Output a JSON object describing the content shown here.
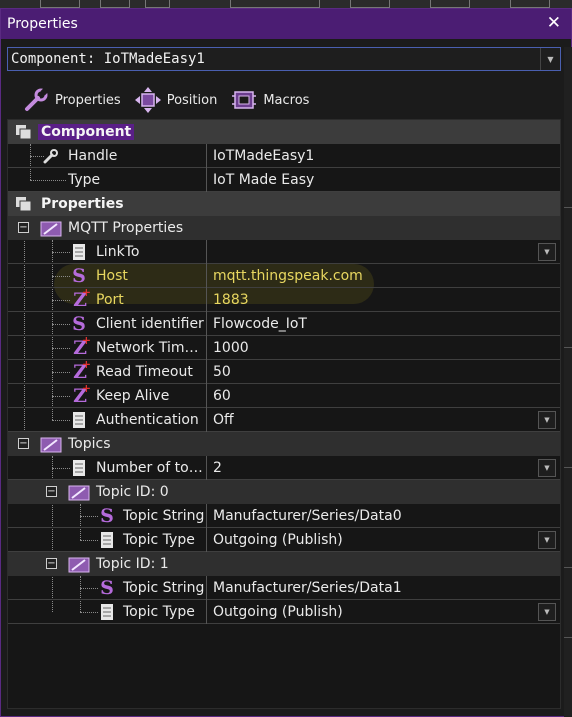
{
  "window": {
    "title": "Properties",
    "close_glyph": "✕"
  },
  "component_select": {
    "value": "Component: IoTMadeEasy1"
  },
  "toolbar": {
    "properties_label": "Properties",
    "position_label": "Position",
    "macros_label": "Macros"
  },
  "grid": {
    "component_header": "Component",
    "handle_label": "Handle",
    "handle_value": "IoTMadeEasy1",
    "type_label": "Type",
    "type_value": "IoT Made Easy",
    "properties_header": "Properties",
    "mqtt_group": "MQTT Properties",
    "linkto_label": "LinkTo",
    "linkto_value": "",
    "host_label": "Host",
    "host_value": "mqtt.thingspeak.com",
    "port_label": "Port",
    "port_value": "1883",
    "client_label": "Client identifier",
    "client_value": "Flowcode_IoT",
    "nettimeout_label": "Network Tim…",
    "nettimeout_value": "1000",
    "readtimeout_label": "Read Timeout",
    "readtimeout_value": "50",
    "keepalive_label": "Keep Alive",
    "keepalive_value": "60",
    "auth_label": "Authentication",
    "auth_value": "Off",
    "topics_group": "Topics",
    "numtopics_label": "Number of to…",
    "numtopics_value": "2",
    "topic0_group": "Topic ID: 0",
    "topic0_string_label": "Topic String",
    "topic0_string_value": "Manufacturer/Series/Data0",
    "topic0_type_label": "Topic Type",
    "topic0_type_value": "Outgoing (Publish)",
    "topic1_group": "Topic ID: 1",
    "topic1_string_label": "Topic String",
    "topic1_string_value": "Manufacturer/Series/Data1",
    "topic1_type_label": "Topic Type",
    "topic1_type_value": "Outgoing (Publish)"
  },
  "colors": {
    "titlebar": "#4b1d73",
    "accent_purple": "#b56bdb",
    "highlight_yellow": "#e8d760",
    "category_bg": "#3c3c3c"
  },
  "icons": {
    "wrench": "wrench-icon",
    "position": "position-icon",
    "macros": "macros-icon",
    "string_property": "string-icon",
    "integer_property": "integer-icon",
    "list_property": "list-icon",
    "folder": "folder-icon"
  }
}
